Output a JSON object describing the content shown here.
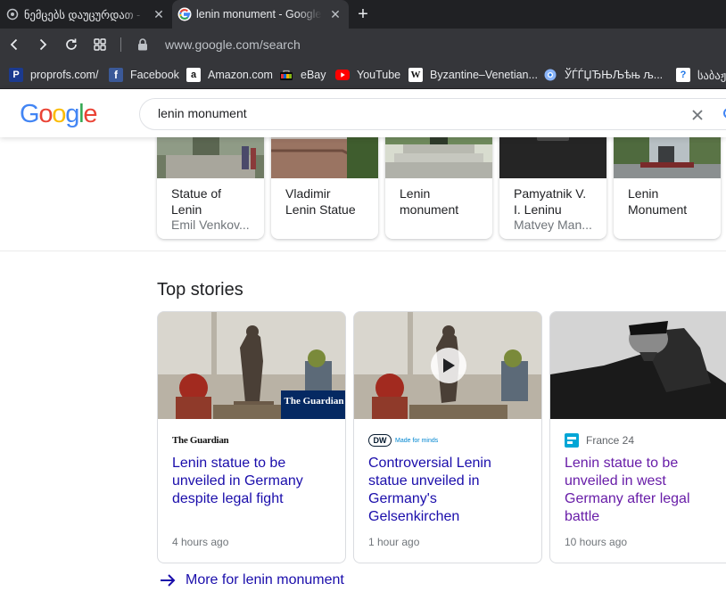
{
  "browser": {
    "tabs": [
      {
        "title": "ნემცებს დაუცურდათ - ",
        "active": false
      },
      {
        "title": "lenin monument - Google S",
        "active": true
      }
    ],
    "new_tab_label": "+",
    "url": "www.google.com/search",
    "bookmarks": [
      {
        "label": "proprofs.com/",
        "icon": "proprofs-icon"
      },
      {
        "label": "Facebook",
        "icon": "facebook-icon"
      },
      {
        "label": "Amazon.com",
        "icon": "amazon-icon"
      },
      {
        "label": "eBay",
        "icon": "ebay-icon"
      },
      {
        "label": "YouTube",
        "icon": "youtube-icon"
      },
      {
        "label": "Byzantine–Venetian...",
        "icon": "wikipedia-icon"
      },
      {
        "label": "ЎЃЃЏЂЊЉѣњ љ...",
        "icon": "globe-icon"
      },
      {
        "label": "საბაჟ",
        "icon": "unknown-page-icon"
      }
    ]
  },
  "google": {
    "logo_letters": [
      "G",
      "o",
      "o",
      "g",
      "l",
      "e"
    ],
    "logo_colors": [
      "#4285f4",
      "#ea4335",
      "#fbbc05",
      "#4285f4",
      "#34a853",
      "#ea4335"
    ],
    "query": "lenin monument"
  },
  "image_cards": [
    {
      "line1": "Statue of",
      "line2": "Lenin",
      "source": "Emil Venkov..."
    },
    {
      "line1": "Vladimir",
      "line2": "Lenin Statue",
      "source": ""
    },
    {
      "line1": "Lenin",
      "line2": "monument",
      "source": ""
    },
    {
      "line1": "Pamyatnik V.",
      "line2": "I. Leninu",
      "source": "Matvey Man..."
    },
    {
      "line1": "Lenin",
      "line2": "Monument",
      "source": ""
    }
  ],
  "top_stories": {
    "title": "Top stories",
    "stories": [
      {
        "publisher": "The Guardian",
        "headline": "Lenin statue to be unveiled in Germany despite legal fight",
        "time": "4 hours ago",
        "image_badge": "The Guardian"
      },
      {
        "publisher": "DW",
        "publisher_tagline": "Made for minds",
        "headline": "Controversial Lenin statue unveiled in Germany's Gelsenkirchen",
        "time": "1 hour ago"
      },
      {
        "publisher": "France 24",
        "headline": "Lenin statue to be unveiled in west Germany after legal battle",
        "time": "10 hours ago"
      }
    ],
    "more_label": "More for lenin monument"
  },
  "colors": {
    "link": "#1a0dab",
    "visited": "#681da8",
    "chrome_dark": "#202124",
    "chrome_toolbar": "#35363a"
  }
}
